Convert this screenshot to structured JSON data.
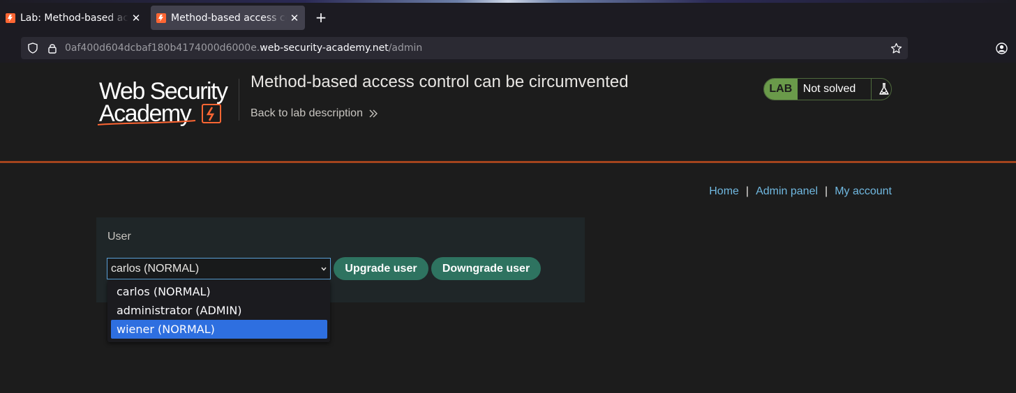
{
  "browser": {
    "tabs": [
      {
        "title": "Lab: Method-based access control can be circumvented",
        "active": false
      },
      {
        "title": "Method-based access control can be circumvented",
        "active": true
      }
    ],
    "url_prefix": "0af400d604dcbaf180b4174000d6000e.",
    "url_domain": "web-security-academy.net",
    "url_path": "/admin"
  },
  "header": {
    "logo_line1": "Web Security",
    "logo_line2": "Academy",
    "lab_title": "Method-based access control can be circumvented",
    "back_link": "Back to lab description",
    "lab_badge": "LAB",
    "lab_status": "Not solved"
  },
  "nav": {
    "home": "Home",
    "separator": "|",
    "admin_panel": "Admin panel",
    "my_account": "My account"
  },
  "form": {
    "label": "User",
    "selected_value": "carlos (NORMAL)",
    "options": [
      "carlos (NORMAL)",
      "administrator (ADMIN)",
      "wiener (NORMAL)"
    ],
    "highlighted_option": "wiener (NORMAL)",
    "upgrade_label": "Upgrade user",
    "downgrade_label": "Downgrade user"
  },
  "colors": {
    "header_rule": "#a4441d",
    "button": "#2e7360",
    "lab_badge": "#6a9a4a",
    "link": "#70b8e0",
    "dropdown_highlight": "#2e6fe0"
  }
}
